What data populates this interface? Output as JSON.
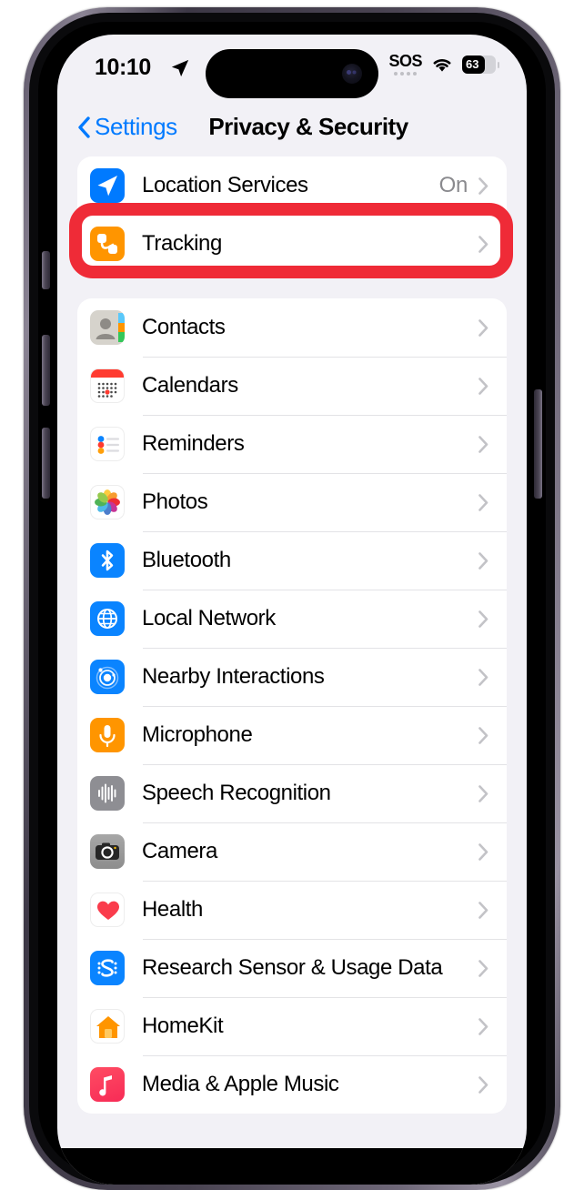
{
  "status_bar": {
    "time": "10:10",
    "location_icon": "location-arrow-icon",
    "sos_label": "SOS",
    "wifi_icon": "wifi-icon",
    "battery_percent": "63",
    "battery_icon": "battery-icon"
  },
  "nav": {
    "back_label": "Settings",
    "back_icon": "chevron-left-icon",
    "title": "Privacy & Security"
  },
  "annotation": {
    "color": "#EF2B37",
    "target": "Location Services"
  },
  "groups": [
    {
      "rows": [
        {
          "label": "Location Services",
          "value": "On",
          "icon": "location-services-icon",
          "highlighted": true
        },
        {
          "label": "Tracking",
          "value": "",
          "icon": "tracking-icon",
          "highlighted": false
        }
      ]
    },
    {
      "rows": [
        {
          "label": "Contacts",
          "value": "",
          "icon": "contacts-icon"
        },
        {
          "label": "Calendars",
          "value": "",
          "icon": "calendar-icon"
        },
        {
          "label": "Reminders",
          "value": "",
          "icon": "reminders-icon"
        },
        {
          "label": "Photos",
          "value": "",
          "icon": "photos-icon"
        },
        {
          "label": "Bluetooth",
          "value": "",
          "icon": "bluetooth-icon"
        },
        {
          "label": "Local Network",
          "value": "",
          "icon": "local-network-icon"
        },
        {
          "label": "Nearby Interactions",
          "value": "",
          "icon": "nearby-interactions-icon"
        },
        {
          "label": "Microphone",
          "value": "",
          "icon": "microphone-icon"
        },
        {
          "label": "Speech Recognition",
          "value": "",
          "icon": "speech-recognition-icon"
        },
        {
          "label": "Camera",
          "value": "",
          "icon": "camera-icon"
        },
        {
          "label": "Health",
          "value": "",
          "icon": "health-icon"
        },
        {
          "label": "Research Sensor & Usage Data",
          "value": "",
          "icon": "research-sensor-icon"
        },
        {
          "label": "HomeKit",
          "value": "",
          "icon": "homekit-icon"
        },
        {
          "label": "Media & Apple Music",
          "value": "",
          "icon": "media-apple-music-icon"
        }
      ]
    }
  ],
  "colors": {
    "accent_blue": "#007AFF",
    "annotation_red": "#EF2B37",
    "value_gray": "#8A8A8E",
    "background": "#F2F1F6"
  }
}
